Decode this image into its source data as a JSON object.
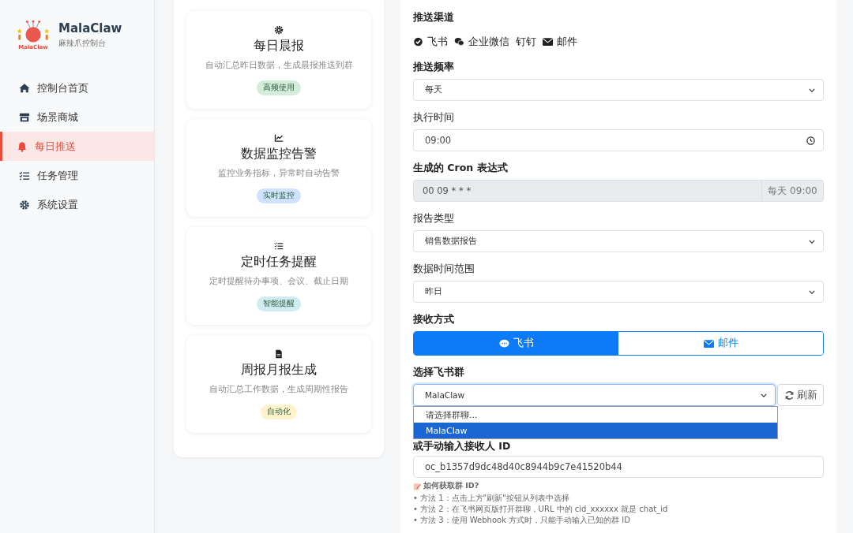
{
  "sidebar": {
    "logo_text": "MalaClaw",
    "title": "MalaClaw",
    "subtitle": "麻辣爪控制台",
    "items": [
      {
        "label": "控制台首页",
        "selected": false
      },
      {
        "label": "场景商城",
        "selected": false
      },
      {
        "label": "每日推送",
        "selected": true
      },
      {
        "label": "任务管理",
        "selected": false
      },
      {
        "label": "系统设置",
        "selected": false
      }
    ]
  },
  "scenarios": [
    {
      "title": "每日晨报",
      "description": "自动汇总昨日数据，生成晨报推送到群",
      "tag": "高频使用",
      "color": "#d4edda"
    },
    {
      "title": "数据监控告警",
      "description": "监控业务指标，异常时自动告警",
      "tag": "实时监控",
      "color": "#cfe2ff"
    },
    {
      "title": "定时任务提醒",
      "description": "定时提醒待办事项、会议、截止日期",
      "tag": "智能提醒",
      "color": "#d1ecf1"
    },
    {
      "title": "周报月报生成",
      "description": "自动汇总工作数据，生成周期性报告",
      "tag": "自动化",
      "color": "#fff3cd"
    }
  ],
  "form": {
    "channels_label": "推送渠道",
    "channels": [
      "飞书",
      "企业微信",
      "钉钉",
      "邮件"
    ],
    "frequency_label": "推送频率",
    "frequency": "每天",
    "time_label": "执行时间",
    "time": "09:00",
    "cron_label": "生成的 Cron 表达式",
    "cron": "00 09 * * *",
    "cron_hint": "每天 09:00",
    "report_type_label": "报告类型",
    "report_type": "销售数据报告",
    "range_label": "数据时间范围",
    "range": "昨日",
    "receive_label": "接收方式",
    "receive_options": [
      {
        "label": "飞书",
        "selected": true
      },
      {
        "label": "邮件",
        "selected": false
      }
    ],
    "group_label": "选择飞书群",
    "group": "MalaClaw",
    "refresh": "刷新",
    "group_options": [
      {
        "label": "请选择群聊...",
        "selected": false
      },
      {
        "label": "MalaClaw",
        "selected": true
      }
    ],
    "manual_label": "或手动输入接收人 ID",
    "manual_value": "oc_b1357d9dc48d40c8944b9c7e41520b44",
    "help_title": "如何获取群 ID?",
    "help_lines": [
      "• 方法 1：点击上方\"刷新\"按钮从列表中选择",
      "• 方法 2：在飞书网页版打开群聊，URL 中的 cid_xxxxxx 就是 chat_id",
      "• 方法 3：使用 Webhook 方式时，只能手动输入已知的群 ID"
    ]
  }
}
